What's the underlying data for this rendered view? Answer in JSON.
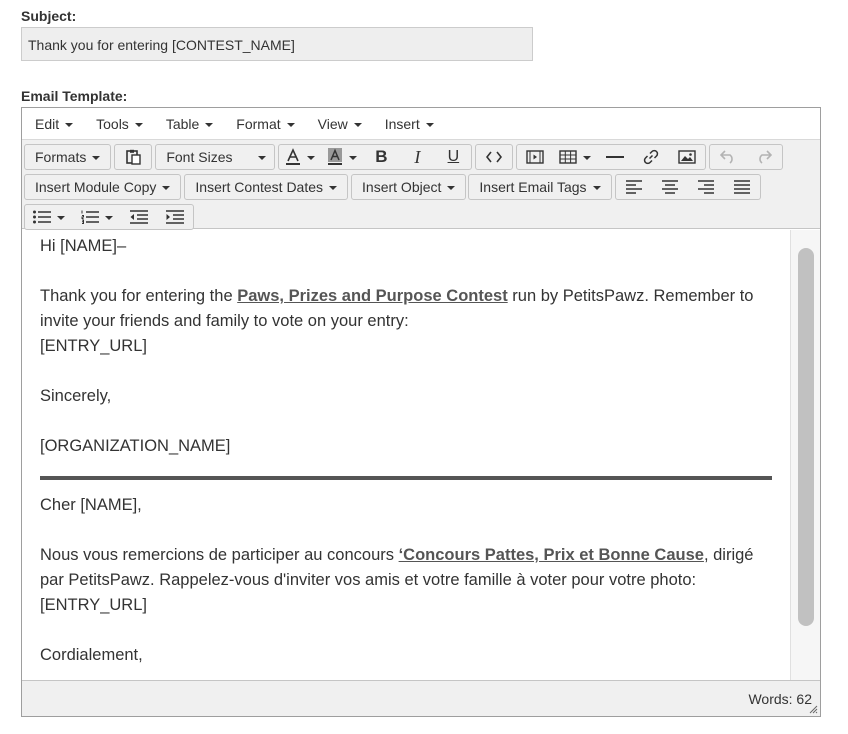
{
  "subject": {
    "label": "Subject:",
    "value": "Thank you for entering [CONTEST_NAME]"
  },
  "template": {
    "label": "Email Template:"
  },
  "menubar": {
    "items": [
      "Edit",
      "Tools",
      "Table",
      "Format",
      "View",
      "Insert"
    ]
  },
  "toolbar": {
    "formats": "Formats",
    "font_sizes": "Font Sizes",
    "insert_module_copy": "Insert Module Copy",
    "insert_contest_dates": "Insert Contest Dates",
    "insert_object": "Insert Object",
    "insert_email_tags": "Insert Email Tags",
    "icons": {
      "row1": [
        "paste-icon",
        "font-color-icon",
        "background-color-icon",
        "bold-icon",
        "italic-icon",
        "underline-icon",
        "source-code-icon",
        "media-icon",
        "table-icon",
        "horizontal-rule-icon",
        "link-icon",
        "image-icon",
        "undo-icon",
        "redo-icon"
      ],
      "row2": [
        "align-left-icon",
        "align-center-icon",
        "align-right-icon",
        "justify-icon"
      ],
      "row3": [
        "bullet-list-icon",
        "numbered-list-icon",
        "outdent-icon",
        "indent-icon"
      ]
    }
  },
  "content": {
    "greeting_en": "Hi [NAME]–",
    "body_en_pre": "Thank you for entering the ",
    "contest_link_en": "Paws, Prizes and Purpose Contest",
    "body_en_post": " run by PetitsPawz. Remember to invite your friends and family to vote on your entry:",
    "entry_url_en": "[ENTRY_URL]",
    "signoff_en": "Sincerely,",
    "org_name": "[ORGANIZATION_NAME]",
    "greeting_fr": "Cher [NAME],",
    "body_fr_pre": "Nous vous remercions de participer au concours ",
    "contest_link_fr": "‘Concours Pattes, Prix et Bonne Cause",
    "body_fr_post": ", dirigé par PetitsPawz. Rappelez-vous d'inviter vos amis et votre famille à voter pour votre photo:",
    "entry_url_fr": "[ENTRY_URL]",
    "signoff_fr": "Cordialement,"
  },
  "status": {
    "word_count": "Words: 62"
  }
}
